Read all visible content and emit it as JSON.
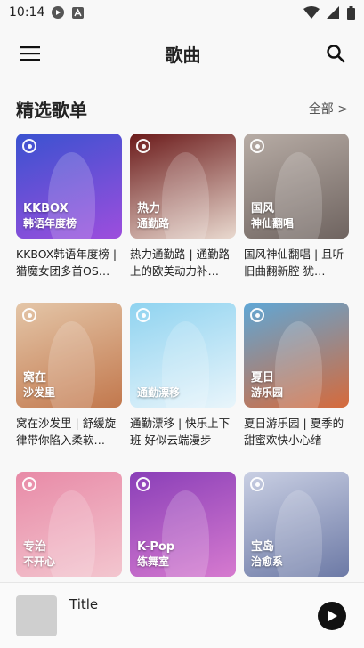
{
  "status_bar": {
    "time": "10:14"
  },
  "app_bar": {
    "title": "歌曲"
  },
  "section": {
    "title": "精选歌单",
    "more_label": "全部 >"
  },
  "playlists": [
    {
      "cover_line1": "KKBOX",
      "cover_line2": "韩语年度榜",
      "caption": "KKBOX韩语年度榜 | 猎魔女团多首OS…",
      "colors": [
        "#3a52d0",
        "#9d4edd"
      ]
    },
    {
      "cover_line1": "热力",
      "cover_line2": "通勤路",
      "caption": "热力通勤路 | 通勤路上的欧美动力补…",
      "colors": [
        "#6b1a1a",
        "#e9d9cf"
      ]
    },
    {
      "cover_line1": "国风",
      "cover_line2": "神仙翻唱",
      "caption": "国风神仙翻唱 | 且听旧曲翻新腔 犹…",
      "colors": [
        "#b7aca5",
        "#6f6460"
      ]
    },
    {
      "cover_line1": "窝在",
      "cover_line2": "沙发里",
      "caption": "窝在沙发里 | 舒缓旋律带你陷入柔软…",
      "colors": [
        "#e4c6a8",
        "#c2784d"
      ]
    },
    {
      "cover_line1": "",
      "cover_line2": "通勤漂移",
      "caption": "通勤漂移 | 快乐上下班 好似云端漫步",
      "colors": [
        "#8fd3f0",
        "#e9f5fb"
      ]
    },
    {
      "cover_line1": "夏日",
      "cover_line2": "游乐园",
      "caption": "夏日游乐园 | 夏季的甜蜜欢快小心绪",
      "colors": [
        "#5fa7d6",
        "#d66a3b"
      ]
    },
    {
      "cover_line1": "专治",
      "cover_line2": "不开心",
      "caption": "",
      "colors": [
        "#e88aa7",
        "#f3c6cf"
      ]
    },
    {
      "cover_line1": "K-Pop",
      "cover_line2": "练舞室",
      "caption": "",
      "colors": [
        "#8a3fb8",
        "#d67acf"
      ]
    },
    {
      "cover_line1": "宝岛",
      "cover_line2": "治愈系",
      "caption": "",
      "colors": [
        "#c9cfe3",
        "#6d7aa6"
      ]
    }
  ],
  "player": {
    "title": "Title"
  },
  "icons": {
    "menu": "menu-icon",
    "search": "search-icon",
    "play": "play-icon",
    "wifi": "wifi-icon",
    "signal": "signal-icon",
    "battery": "battery-icon"
  }
}
